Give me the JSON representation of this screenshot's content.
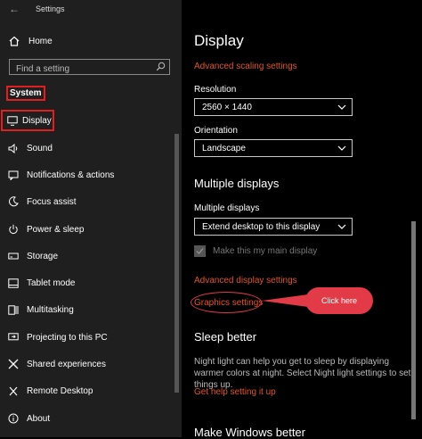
{
  "titlebar": {
    "back_icon": "←",
    "title": "Settings",
    "minimize": "–",
    "maximize": "☐",
    "close": "✕"
  },
  "sidebar": {
    "home_label": "Home",
    "search_placeholder": "Find a setting",
    "section_label": "System",
    "items": [
      {
        "label": "Display",
        "icon": "monitor-icon"
      },
      {
        "label": "Sound",
        "icon": "speaker-icon"
      },
      {
        "label": "Notifications & actions",
        "icon": "notification-icon"
      },
      {
        "label": "Focus assist",
        "icon": "moon-icon"
      },
      {
        "label": "Power & sleep",
        "icon": "power-icon"
      },
      {
        "label": "Storage",
        "icon": "drive-icon"
      },
      {
        "label": "Tablet mode",
        "icon": "tablet-icon"
      },
      {
        "label": "Multitasking",
        "icon": "multitask-icon"
      },
      {
        "label": "Projecting to this PC",
        "icon": "project-icon"
      },
      {
        "label": "Shared experiences",
        "icon": "shared-icon"
      },
      {
        "label": "Remote Desktop",
        "icon": "remote-icon"
      },
      {
        "label": "About",
        "icon": "info-icon"
      }
    ]
  },
  "main": {
    "title": "Display",
    "advanced_scaling": "Advanced scaling settings",
    "resolution_label": "Resolution",
    "resolution_value": "2560 × 1440",
    "orientation_label": "Orientation",
    "orientation_value": "Landscape",
    "multiple_heading": "Multiple displays",
    "multiple_label": "Multiple displays",
    "multiple_value": "Extend desktop to this display",
    "main_display_label": "Make this my main display",
    "advanced_display": "Advanced display settings",
    "graphics_settings": "Graphics settings",
    "sleep_heading": "Sleep better",
    "sleep_text": "Night light can help you get to sleep by displaying warmer colors at night. Select Night light settings to set things up.",
    "help_link": "Get help setting it up",
    "bottom_heading": "Make Windows better"
  },
  "annotation": {
    "callout_text": "Click here"
  },
  "colors": {
    "accent": "#e2552a",
    "highlight": "#e02020",
    "callout": "#e23a47"
  }
}
